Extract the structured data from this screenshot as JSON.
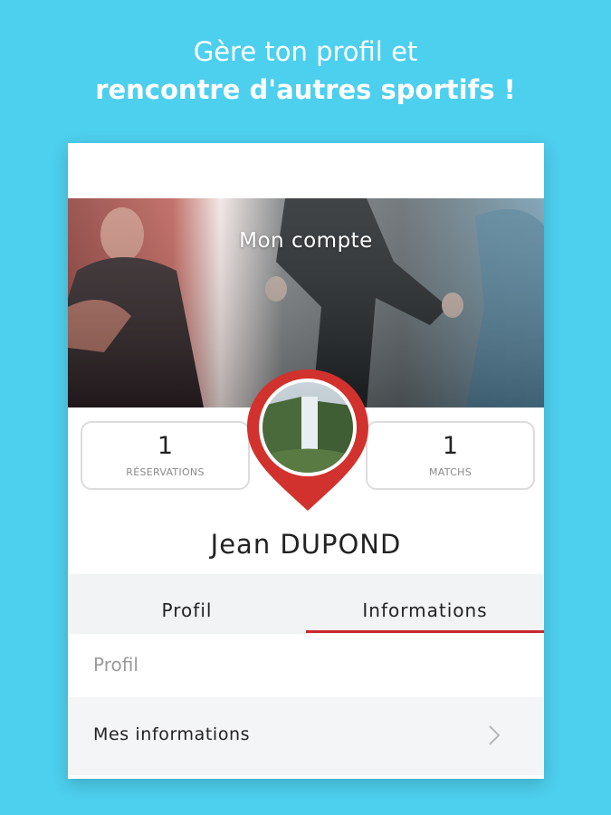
{
  "headline": {
    "line1": "Gère ton profil et",
    "line2": "rencontre d'autres sportifs !"
  },
  "hero": {
    "title": "Mon compte"
  },
  "stats": {
    "reservations": {
      "value": "1",
      "label": "RÉSERVATIONS"
    },
    "matchs": {
      "value": "1",
      "label": "MATCHS"
    }
  },
  "user": {
    "name": "Jean  DUPOND"
  },
  "tabs": [
    {
      "label": "Profil",
      "selected": false
    },
    {
      "label": "Informations",
      "selected": true
    }
  ],
  "section": {
    "header": "Profil"
  },
  "list": [
    {
      "label": "Mes informations",
      "icon": "chevron-right-icon"
    }
  ],
  "colors": {
    "background": "#4dcfee",
    "accent": "#c8282d",
    "tab_bar": "#f2f3f5"
  }
}
